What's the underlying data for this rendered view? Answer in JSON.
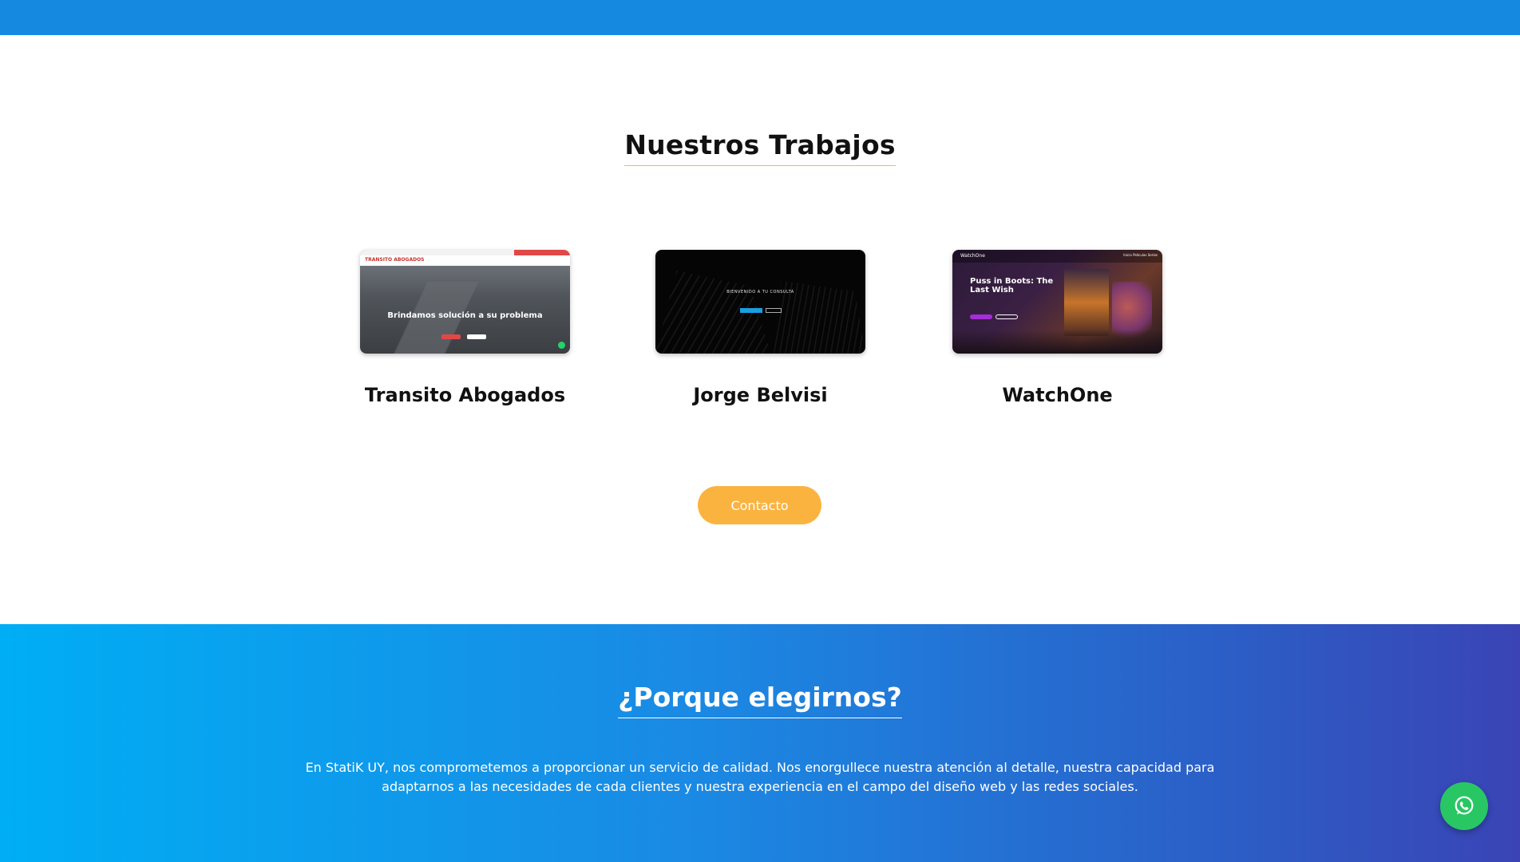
{
  "colors": {
    "top_bar": "#1589e0",
    "accent": "#fbb340",
    "heading_text": "#111111",
    "whatsapp": "#28c763",
    "gradient_start": "#00aef5",
    "gradient_end": "#3a44b5"
  },
  "works": {
    "title": "Nuestros Trabajos",
    "projects": [
      {
        "name": "Transito Abogados",
        "thumbnail_logo": "TRANSITO ABOGADOS",
        "thumbnail_headline": "Brindamos solución a su problema"
      },
      {
        "name": "Jorge Belvisi",
        "thumbnail_headline": "BIENVENIDO A TU CONSULTA"
      },
      {
        "name": "WatchOne",
        "thumbnail_logo": "WatchOne",
        "thumbnail_nav": "Inicio  Películas  Series",
        "thumbnail_headline": "Puss in Boots: The Last Wish"
      }
    ],
    "contact_label": "Contacto"
  },
  "why": {
    "title": "¿Porque elegirnos?",
    "text": "En StatiK UY, nos comprometemos a proporcionar un servicio de calidad. Nos enorgullece nuestra atención al detalle, nuestra capacidad para adaptarnos a las necesidades de cada clientes y nuestra experiencia en el campo del diseño web y las redes sociales."
  },
  "icons": {
    "whatsapp": "whatsapp-icon"
  }
}
